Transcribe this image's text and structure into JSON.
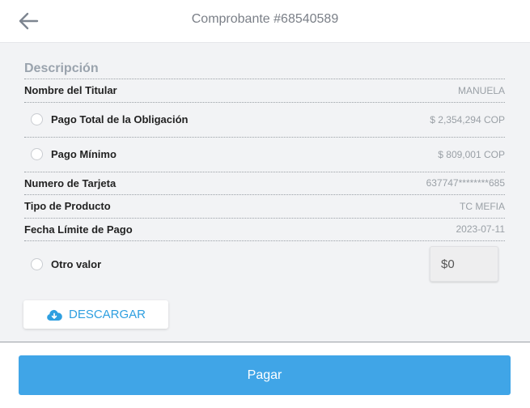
{
  "header": {
    "title": "Comprobante #68540589"
  },
  "description": {
    "title": "Descripción",
    "holder": {
      "label": "Nombre del Titular",
      "value": "MANUELA"
    },
    "total_payment": {
      "label": "Pago Total de la Obligación",
      "value": "$ 2,354,294 COP"
    },
    "minimum_payment": {
      "label": "Pago Mínimo",
      "value": "$ 809,001 COP"
    },
    "card_number": {
      "label": "Numero de Tarjeta",
      "value": "637747********685"
    },
    "product_type": {
      "label": "Tipo de Producto",
      "value": "TC MEFIA"
    },
    "due_date": {
      "label": "Fecha Límite de Pago",
      "value": "2023-07-11"
    },
    "other_value": {
      "label": "Otro valor",
      "amount": "$0"
    }
  },
  "actions": {
    "download_label": "DESCARGAR",
    "pay_label": "Pagar"
  },
  "colors": {
    "accent": "#40a5e7",
    "download_text": "#2e9fe0",
    "section_title": "#9aa3ad",
    "muted_value": "#9aa0a6"
  },
  "icons": {
    "back": "arrow-left-icon",
    "download": "cloud-download-icon"
  }
}
